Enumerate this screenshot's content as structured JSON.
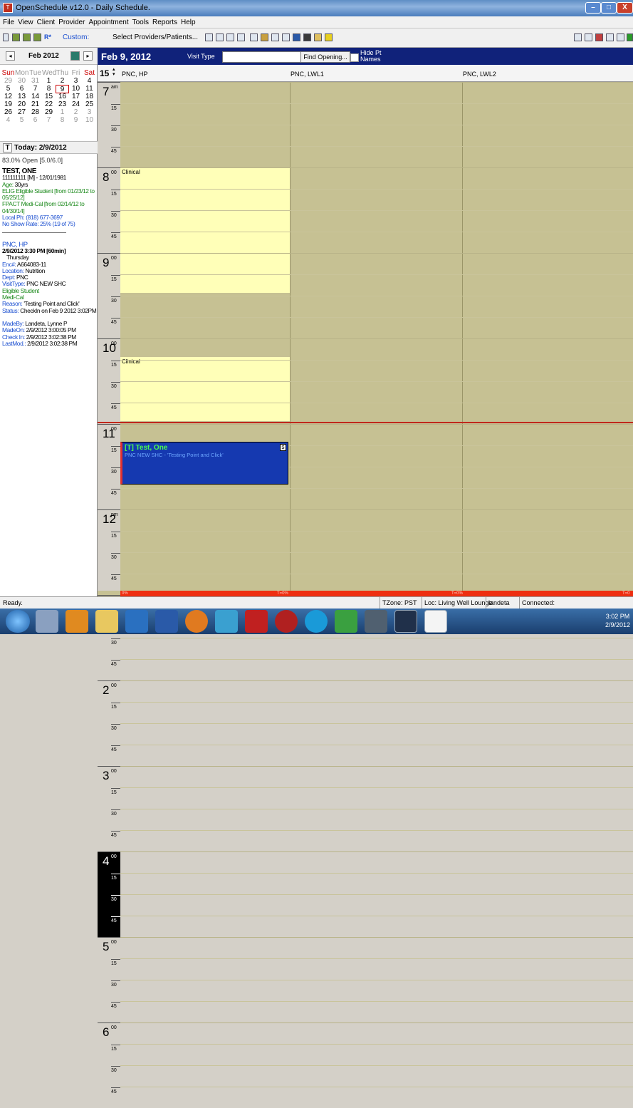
{
  "window": {
    "title": "OpenSchedule v12.0 - Daily Schedule."
  },
  "menu": [
    "File",
    "View",
    "Client",
    "Provider",
    "Appointment",
    "Tools",
    "Reports",
    "Help"
  ],
  "toolbar": {
    "custom_label": "Custom:",
    "select_label": "Select Providers/Patients..."
  },
  "calendar": {
    "month": "Feb 2012",
    "weekdays": [
      "Sun",
      "Mon",
      "Tue",
      "Wed",
      "Thu",
      "Fri",
      "Sat"
    ],
    "weeks": [
      [
        "29",
        "30",
        "31",
        "1",
        "2",
        "3",
        "4"
      ],
      [
        "5",
        "6",
        "7",
        "8",
        "9",
        "10",
        "11"
      ],
      [
        "12",
        "13",
        "14",
        "15",
        "16",
        "17",
        "18"
      ],
      [
        "19",
        "20",
        "21",
        "22",
        "23",
        "24",
        "25"
      ],
      [
        "26",
        "27",
        "28",
        "29",
        "1",
        "2",
        "3"
      ],
      [
        "4",
        "5",
        "6",
        "7",
        "8",
        "9",
        "10"
      ]
    ],
    "today_btn": "T",
    "today": "Today: 2/9/2012",
    "selected": "9"
  },
  "open_pct": "83.0% Open [5.0/6.0]",
  "patient": {
    "name": "TEST, ONE",
    "id_line": "111111111 [M] - 12/01/1981",
    "age_lbl": "Age:",
    "age": "30yrs",
    "elig1": "ELIG Eligible Student [from 01/23/12 to 05/25/12]",
    "elig2": "FPACT Medi-Cal [from 02/14/12 to 04/30/14]",
    "phone_lbl": "Local Ph:",
    "phone": "(818) 677-3697",
    "noshow_lbl": "No Show Rate:",
    "noshow": "25% (19 of 75)"
  },
  "appointment_info": {
    "provider": "PNC, HP",
    "datetime": "2/9/2012 3:30 PM [60min]",
    "day": "Thursday",
    "enc_lbl": "Enc#:",
    "enc": "A664083-11",
    "loc_lbl": "Location:",
    "loc": "Nutrition",
    "dept_lbl": "Dept:",
    "dept": "PNC",
    "vt_lbl": "VisitType:",
    "vt": "PNC NEW SHC",
    "elig": "Eligible Student",
    "medi": "Medi-Cal",
    "reason_lbl": "Reason:",
    "reason": "'Testing Point and Click'",
    "status_lbl": "Status:",
    "status": "CheckIn on Feb 9 2012 3:02PM",
    "madeby_lbl": "MadeBy:",
    "madeby": "Landeta, Lynne P",
    "madeon_lbl": "MadeOn:",
    "madeon": "2/9/2012 3:00:05 PM",
    "checkin_lbl": "Check In:",
    "checkin": "2/9/2012 3:02:38 PM",
    "lastmod_lbl": "LastMod.:",
    "lastmod": "2/9/2012 3:02:38 PM"
  },
  "schedule": {
    "date": "Feb 9, 2012",
    "visit_type_label": "Visit Type",
    "find_btn": "Find Opening...",
    "hide_pt": "Hide Pt Names",
    "zoom": "15",
    "columns": [
      "PNC, HP",
      "PNC, LWL1",
      "PNC, LWL2"
    ],
    "hours": [
      "7",
      "8",
      "9",
      "10",
      "11",
      "12",
      "1",
      "2",
      "3",
      "4",
      "5",
      "6"
    ],
    "ampm": {
      "7": "am",
      "12": "pm"
    },
    "quarters": [
      "00",
      "15",
      "30",
      "45"
    ],
    "blocks": [
      {
        "label": "Clinical"
      },
      {
        "label": "Clinical"
      }
    ],
    "appt": {
      "name": "[T] Test, One",
      "detail": "PNC NEW SHC - 'Testing Point and Click'",
      "flag": "$"
    },
    "bar_labels": [
      "0%",
      "T=0%",
      "T=0%",
      "T=0"
    ]
  },
  "statusbar": {
    "ready": "Ready.",
    "tzone": "TZone: PST",
    "loc": "Loc: Living Well Lounge",
    "user": "landeta",
    "conn": "Connected: POINTNCLICK\\PRODUCTION"
  },
  "clock": {
    "time": "3:02 PM",
    "date": "2/9/2012"
  },
  "colors": {
    "header": "#10227a",
    "schedule_bg": "#c6c193",
    "block": "#ffffb8",
    "appt": "#1539b0"
  }
}
